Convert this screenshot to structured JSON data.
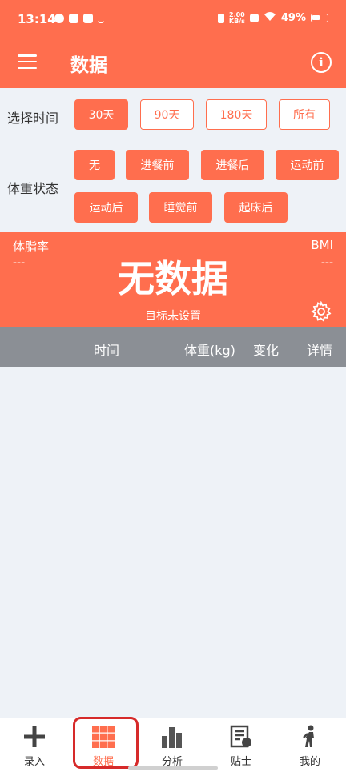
{
  "status": {
    "time": "13:14",
    "speed_top": "2.00",
    "speed_bottom": "KB/s",
    "battery": "49%"
  },
  "app_bar": {
    "title": "数据",
    "info_symbol": "i"
  },
  "filters": {
    "time_label": "选择时间",
    "time_options": [
      "30天",
      "90天",
      "180天",
      "所有"
    ],
    "selected_time": "30天",
    "state_label": "体重状态",
    "state_options": [
      "无",
      "进餐前",
      "进餐后",
      "运动前",
      "运动后",
      "睡觉前",
      "起床后"
    ]
  },
  "summary": {
    "body_fat_label": "体脂率",
    "body_fat_value": "---",
    "bmi_label": "BMI",
    "bmi_value": "---",
    "headline": "无数据",
    "target_text": "目标未设置"
  },
  "table": {
    "columns": [
      "时间",
      "体重(kg)",
      "变化",
      "详情"
    ],
    "rows": []
  },
  "bottom_nav": {
    "items": [
      {
        "label": "录入",
        "icon": "plus-icon"
      },
      {
        "label": "数据",
        "icon": "grid-icon"
      },
      {
        "label": "分析",
        "icon": "bar-chart-icon"
      },
      {
        "label": "贴士",
        "icon": "document-icon"
      },
      {
        "label": "我的",
        "icon": "person-walk-icon"
      }
    ],
    "active": "数据"
  },
  "colors": {
    "accent": "#ff6e4e",
    "header_gray": "#8b8f95",
    "background": "#eef2f7",
    "highlight": "#d62a2a"
  }
}
